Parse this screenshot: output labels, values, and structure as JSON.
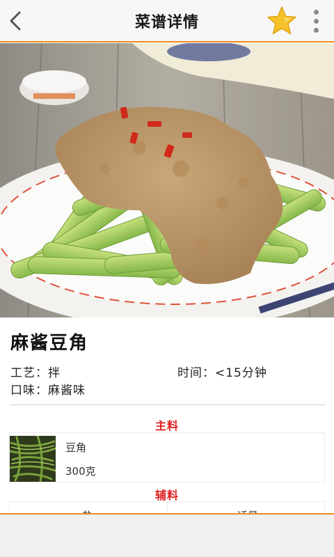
{
  "header": {
    "title": "菜谱详情",
    "back_icon": "chevron-left-icon",
    "favorite_icon": "star-icon",
    "more_icon": "more-vertical-icon",
    "accent_color": "#f08a1c",
    "star_color": "#f6c22c"
  },
  "recipe": {
    "name": "麻酱豆角",
    "technique": "工艺：拌",
    "time": "时间：<15分钟",
    "flavor": "口味：麻酱味"
  },
  "main_ingredients": {
    "title": "主料",
    "items": [
      {
        "name": "豆角",
        "amount": "300克"
      }
    ]
  },
  "auxiliary_ingredients": {
    "title": "辅料",
    "items": [
      {
        "name": "盐"
      },
      {
        "name": "适量"
      }
    ]
  },
  "section_title_color": "#e02020"
}
